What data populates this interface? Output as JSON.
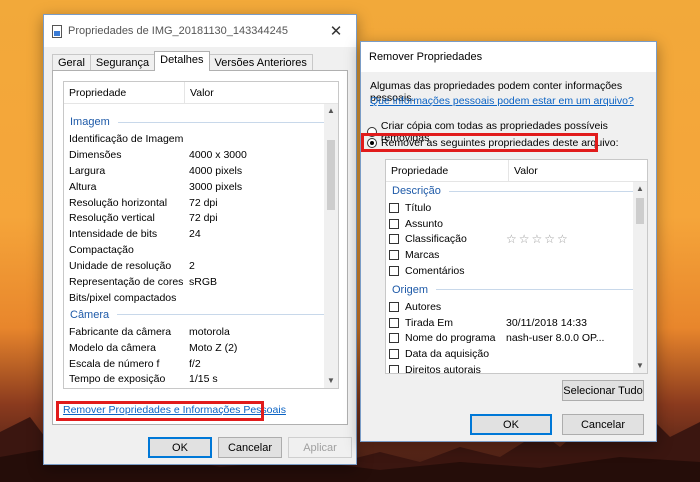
{
  "left_dialog": {
    "title": "Propriedades de IMG_20181130_143344245",
    "tabs": [
      "Geral",
      "Segurança",
      "Detalhes",
      "Versões Anteriores"
    ],
    "active_tab": "Detalhes",
    "columns": {
      "property": "Propriedade",
      "value": "Valor"
    },
    "group_image": "Imagem",
    "image_rows": [
      {
        "k": "Identificação de Imagem",
        "v": ""
      },
      {
        "k": "Dimensões",
        "v": "4000 x 3000"
      },
      {
        "k": "Largura",
        "v": "4000 pixels"
      },
      {
        "k": "Altura",
        "v": "3000 pixels"
      },
      {
        "k": "Resolução horizontal",
        "v": "72 dpi"
      },
      {
        "k": "Resolução vertical",
        "v": "72 dpi"
      },
      {
        "k": "Intensidade de bits",
        "v": "24"
      },
      {
        "k": "Compactação",
        "v": ""
      },
      {
        "k": "Unidade de resolução",
        "v": "2"
      },
      {
        "k": "Representação de cores",
        "v": "sRGB"
      },
      {
        "k": "Bits/pixel compactados",
        "v": ""
      }
    ],
    "group_camera": "Câmera",
    "camera_rows": [
      {
        "k": "Fabricante da câmera",
        "v": "motorola"
      },
      {
        "k": "Modelo da câmera",
        "v": "Moto Z (2)"
      },
      {
        "k": "Escala de número f",
        "v": "f/2"
      },
      {
        "k": "Tempo de exposição",
        "v": "1/15 s"
      }
    ],
    "remove_link": "Remover Propriedades e Informações Pessoais",
    "ok": "OK",
    "cancel": "Cancelar",
    "apply": "Aplicar"
  },
  "right_dialog": {
    "title": "Remover Propriedades",
    "info": "Algumas das propriedades podem conter informações pessoais.",
    "info_link": "Que informações pessoais podem estar em um arquivo?",
    "option_copy": "Criar cópia com todas as propriedades possíveis removidas",
    "option_remove": "Remover as seguintes propriedades deste arquivo:",
    "columns": {
      "property": "Propriedade",
      "value": "Valor"
    },
    "group_description": "Descrição",
    "description_rows": [
      {
        "k": "Título",
        "v": ""
      },
      {
        "k": "Assunto",
        "v": ""
      },
      {
        "k": "Classificação",
        "v": "☆☆☆☆☆"
      },
      {
        "k": "Marcas",
        "v": ""
      },
      {
        "k": "Comentários",
        "v": ""
      }
    ],
    "group_origin": "Origem",
    "origin_rows": [
      {
        "k": "Autores",
        "v": ""
      },
      {
        "k": "Tirada Em",
        "v": "30/11/2018 14:33"
      },
      {
        "k": "Nome do programa",
        "v": "nash-user 8.0.0 OP..."
      },
      {
        "k": "Data da aquisição",
        "v": ""
      },
      {
        "k": "Direitos autorais",
        "v": ""
      }
    ],
    "select_all": "Selecionar Tudo",
    "ok": "OK",
    "cancel": "Cancelar"
  },
  "colors": {
    "highlight_red": "#e11b1b",
    "link_blue": "#0b63c4",
    "group_blue": "#1e5aa8"
  }
}
